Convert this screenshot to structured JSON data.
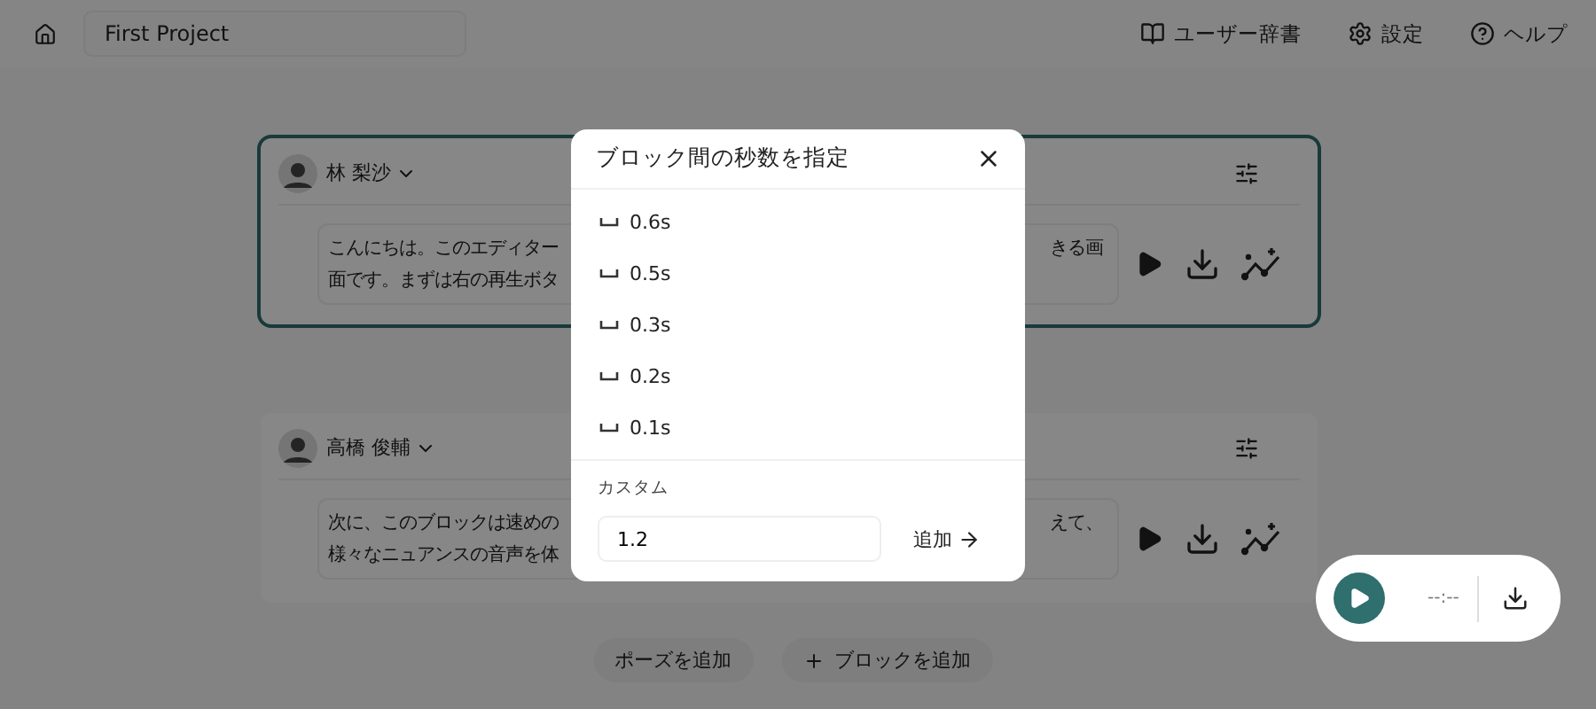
{
  "header": {
    "project_name": "First Project",
    "nav": [
      {
        "label": "ユーザー辞書",
        "kind": "dictionary"
      },
      {
        "label": "設定",
        "kind": "settings"
      },
      {
        "label": "ヘルプ",
        "kind": "help"
      }
    ]
  },
  "blocks": [
    {
      "speaker": "林 梨沙",
      "focused": true,
      "lines": [
        {
          "left": "こんにちは。このエディター",
          "right": "きる画"
        },
        {
          "left": "面です。まずは右の再生ボタ"
        }
      ]
    },
    {
      "speaker": "高橋 俊輔",
      "focused": false,
      "lines": [
        {
          "left": "次に、このブロックは速めの",
          "right": "えて、"
        },
        {
          "left": "様々なニュアンスの音声を体"
        }
      ]
    }
  ],
  "actions": [
    {
      "label": "ポーズを追加",
      "kind": "plain"
    },
    {
      "label": "ブロックを追加",
      "kind": "plus"
    }
  ],
  "player": {
    "time": "--:--"
  },
  "dialog": {
    "title": "ブロック間の秒数を指定",
    "options": [
      {
        "label": "0.6s"
      },
      {
        "label": "0.5s"
      },
      {
        "label": "0.3s"
      },
      {
        "label": "0.2s"
      },
      {
        "label": "0.1s"
      }
    ],
    "custom_label": "カスタム",
    "custom_value": "1.2",
    "add_label": "追加"
  }
}
